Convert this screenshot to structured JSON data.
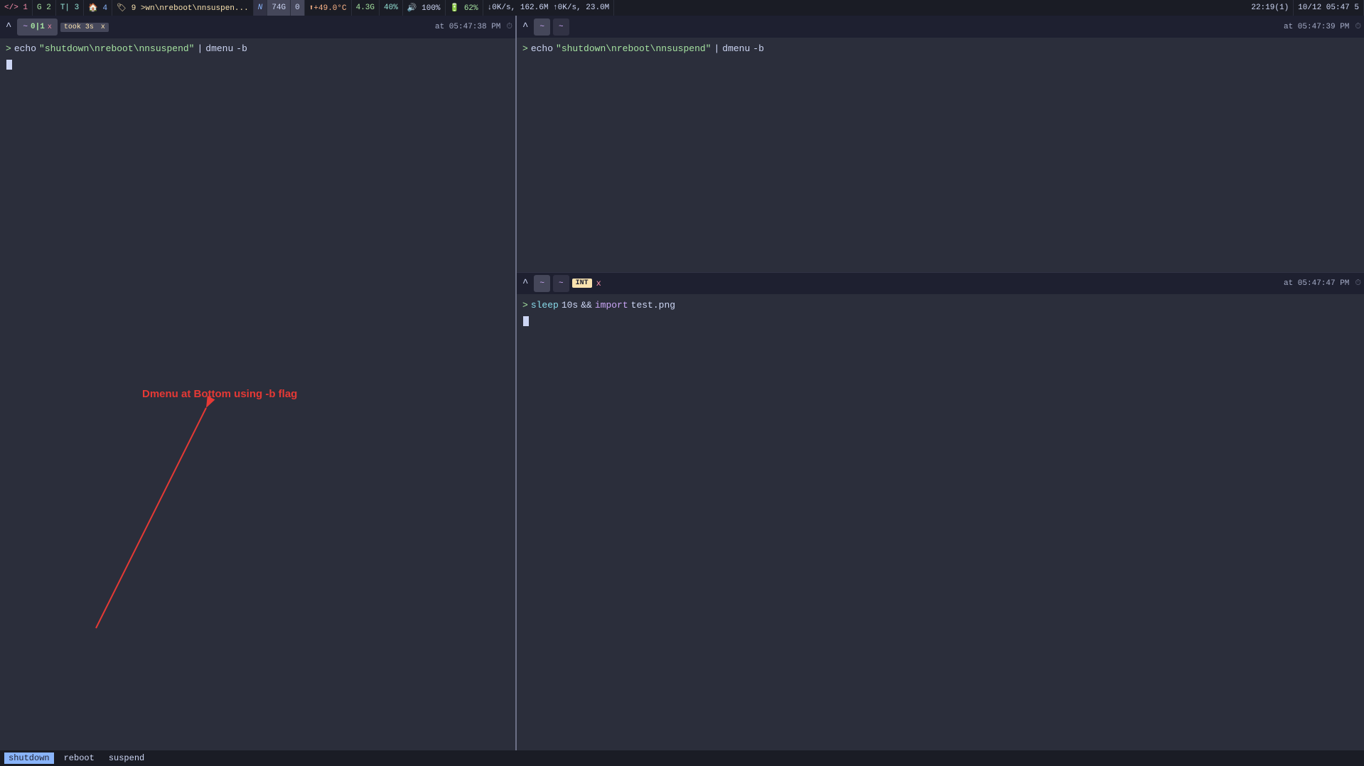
{
  "topbar": {
    "items": [
      {
        "id": "tag1",
        "label": "</> 1",
        "color": "red"
      },
      {
        "id": "tag2",
        "label": "G 2",
        "color": "green"
      },
      {
        "id": "tag3",
        "label": "T| 3",
        "color": "teal"
      },
      {
        "id": "tag4",
        "label": "🏠 4",
        "color": "blue"
      },
      {
        "id": "tag5",
        "label": "🏷 9  >wn\\nreboot\\nnsuspen...",
        "color": "yellow"
      },
      {
        "id": "layout",
        "label": "N",
        "color": ""
      },
      {
        "id": "windows",
        "label": "74G",
        "color": ""
      },
      {
        "id": "zero",
        "label": "0",
        "color": ""
      },
      {
        "id": "temp",
        "label": "⬆+49.0°C",
        "color": "orange"
      },
      {
        "id": "cpu",
        "label": "4.3G",
        "color": "green"
      },
      {
        "id": "mem",
        "label": "40%",
        "color": "teal"
      },
      {
        "id": "vol",
        "label": "🔊 100%",
        "color": ""
      },
      {
        "id": "bat",
        "label": "🔋 62%",
        "color": "green"
      },
      {
        "id": "net",
        "label": "↓0K/s, 162.6M ↑0K/s, 23.0M",
        "color": ""
      },
      {
        "id": "time",
        "label": "22:19(1)",
        "color": ""
      },
      {
        "id": "date",
        "label": "10/12 05:47 5",
        "color": ""
      }
    ]
  },
  "left_pane": {
    "tab": {
      "caret": "^",
      "tilde": "~",
      "number": "0|1",
      "close": "x",
      "took": "took 3s",
      "close2": "x",
      "timestamp": "at 05:47:38 PM",
      "clock": "⏱"
    },
    "prompt": ">",
    "command": "echo \"shutdown\\nreboot\\nnsuspend\" | dmenu -b",
    "cmd_parts": {
      "cmd": "echo",
      "string": "\"shutdown\\nreboot\\nnsuspend\"",
      "pipe": "|",
      "subcmd": "dmenu",
      "flag": "-b"
    }
  },
  "right_pane": {
    "tab1": {
      "caret": "^",
      "tilde": "~",
      "timestamp": "at 05:47:39 PM",
      "clock": "⏱"
    },
    "tab2": {
      "caret": "^",
      "tilde": "~",
      "int_badge": "INT",
      "close": "x",
      "timestamp": "at 05:47:47 PM",
      "clock": "⏱"
    },
    "prompt1": ">",
    "command1": "echo \"shutdown\\nreboot\\nnsuspend\" | dmenu -b",
    "prompt2": ">",
    "command2_parts": {
      "sleep": "sleep",
      "time": "10s",
      "and": "&&",
      "import_kw": "import",
      "file": "test.png"
    }
  },
  "annotation": {
    "text": "Dmenu at Bottom using -b flag",
    "color": "#e53935"
  },
  "dmenu": {
    "items": [
      {
        "label": "shutdown",
        "selected": true
      },
      {
        "label": "reboot",
        "selected": false
      },
      {
        "label": "suspend",
        "selected": false
      }
    ]
  }
}
